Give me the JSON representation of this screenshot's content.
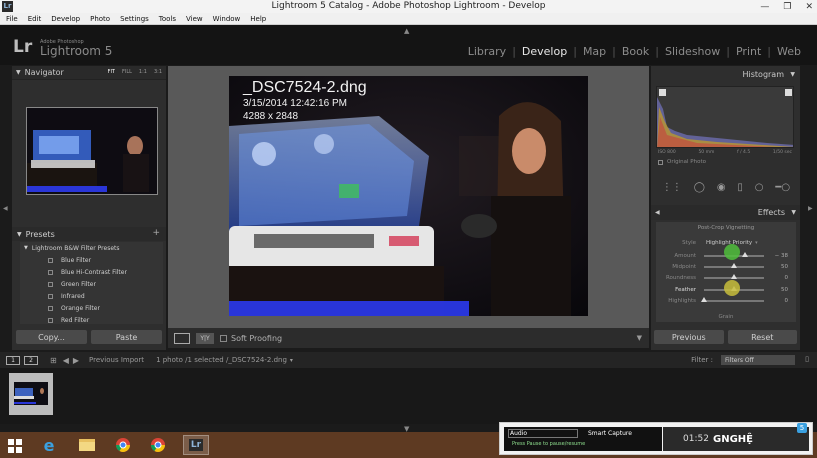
{
  "window": {
    "app_icon": "Lr",
    "title": "Lightroom 5 Catalog - Adobe Photoshop Lightroom - Develop",
    "controls": [
      "—",
      "❐",
      "✕"
    ]
  },
  "menu": [
    "File",
    "Edit",
    "Develop",
    "Photo",
    "Settings",
    "Tools",
    "View",
    "Window",
    "Help"
  ],
  "identity": {
    "logo": "Lr",
    "adobe": "Adobe Photoshop",
    "product": "Lightroom 5"
  },
  "modules": [
    {
      "label": "Library",
      "active": false
    },
    {
      "label": "Develop",
      "active": true
    },
    {
      "label": "Map",
      "active": false
    },
    {
      "label": "Book",
      "active": false
    },
    {
      "label": "Slideshow",
      "active": false
    },
    {
      "label": "Print",
      "active": false
    },
    {
      "label": "Web",
      "active": false
    }
  ],
  "navigator": {
    "title": "Navigator",
    "zoom_options": [
      "FIT",
      "FILL",
      "1:1",
      "3:1"
    ]
  },
  "presets": {
    "title": "Presets",
    "folder": "Lightroom B&W Filter Presets",
    "items": [
      "Blue Filter",
      "Blue Hi-Contrast Filter",
      "Green Filter",
      "Infrared",
      "Orange Filter",
      "Red Filter"
    ]
  },
  "left_buttons": {
    "copy": "Copy...",
    "paste": "Paste"
  },
  "photo": {
    "filename": "_DSC7524-2.dng",
    "datetime": "3/15/2014 12:42:16 PM",
    "dimensions": "4288 x 2848"
  },
  "toolbar": {
    "view_toggle": "Y|Y",
    "soft_proofing": "Soft Proofing"
  },
  "histogram": {
    "title": "Histogram",
    "stats": [
      "ISO 800",
      "50 mm",
      "f / 4.5",
      "1/50 sec"
    ],
    "original_photo": "Original Photo"
  },
  "effects": {
    "title": "Effects",
    "section": "Post-Crop Vignetting",
    "style_label": "Style",
    "style_value": "Highlight Priority",
    "sliders": [
      {
        "label": "Amount",
        "value": "− 38",
        "level": 0.69
      },
      {
        "label": "Midpoint",
        "value": "50",
        "level": 0.5
      },
      {
        "label": "Roundness",
        "value": "0",
        "level": 0.5
      },
      {
        "label": "Feather",
        "value": "50",
        "level": 0.5
      },
      {
        "label": "Highlights",
        "value": "0",
        "level": 0.0
      }
    ],
    "grain": "Grain"
  },
  "right_buttons": {
    "previous": "Previous",
    "reset": "Reset"
  },
  "filmstrip": {
    "screens": [
      "1",
      "2"
    ],
    "source": "Previous Import",
    "selection": "1 photo /1 selected /_DSC7524-2.dng",
    "filter_label": "Filter :",
    "filter_value": "Filters Off"
  },
  "recorder": {
    "audio": "Audio",
    "smart_capture": "Smart Capture",
    "press_pause": "Press Pause to pause/resume",
    "time": "01:52",
    "logo": "GNGHỆ",
    "badge": "5"
  },
  "colors": {
    "panel": "#2e2e2e",
    "accent_active": "#e8e8e8",
    "taskbar": "#5e3a22"
  }
}
